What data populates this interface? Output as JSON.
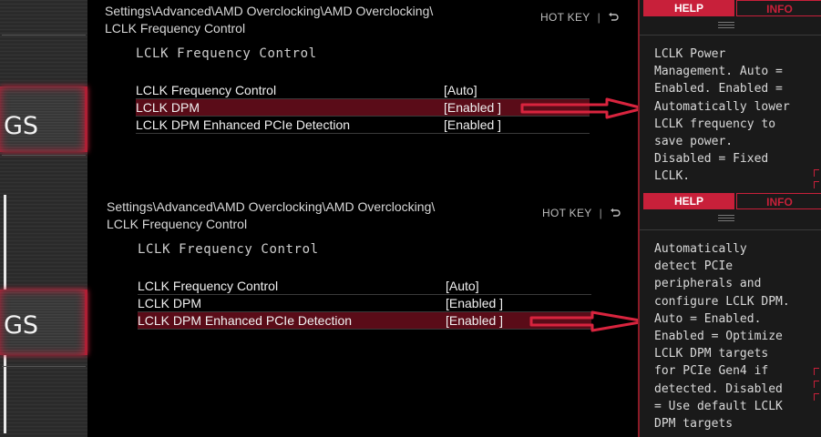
{
  "side": {
    "label": "GS"
  },
  "breadcrumb": "Settings\\Advanced\\AMD Overclocking\\AMD Overclocking\\\nLCLK Frequency Control",
  "hotkey": {
    "label": "HOT KEY",
    "separator": "|",
    "back_icon": "back-arrow-icon"
  },
  "section_title": "LCLK Frequency Control",
  "rows": [
    {
      "label": "LCLK Frequency Control",
      "value": "[Auto]"
    },
    {
      "label": "LCLK DPM",
      "value": "[Enabled ]"
    },
    {
      "label": "LCLK DPM Enhanced PCIe Detection",
      "value": "[Enabled ]"
    }
  ],
  "help_panel": {
    "tab_help": "HELP",
    "tab_info": "INFO"
  },
  "screens": [
    {
      "selected_index": 1,
      "help_text": "LCLK Power\nManagement. Auto =\nEnabled. Enabled =\nAutomatically lower\nLCLK frequency to\nsave power.\nDisabled = Fixed\nLCLK."
    },
    {
      "selected_index": 2,
      "help_text": "Automatically\ndetect PCIe\nperipherals and\nconfigure LCLK DPM.\nAuto = Enabled.\nEnabled = Optimize\nLCLK DPM targets\nfor PCIe Gen4 if\ndetected. Disabled\n= Use default LCLK\nDPM targets"
    }
  ],
  "colors": {
    "accent": "#c8203a",
    "selected_row": "#5a0c18",
    "background": "#000000"
  }
}
